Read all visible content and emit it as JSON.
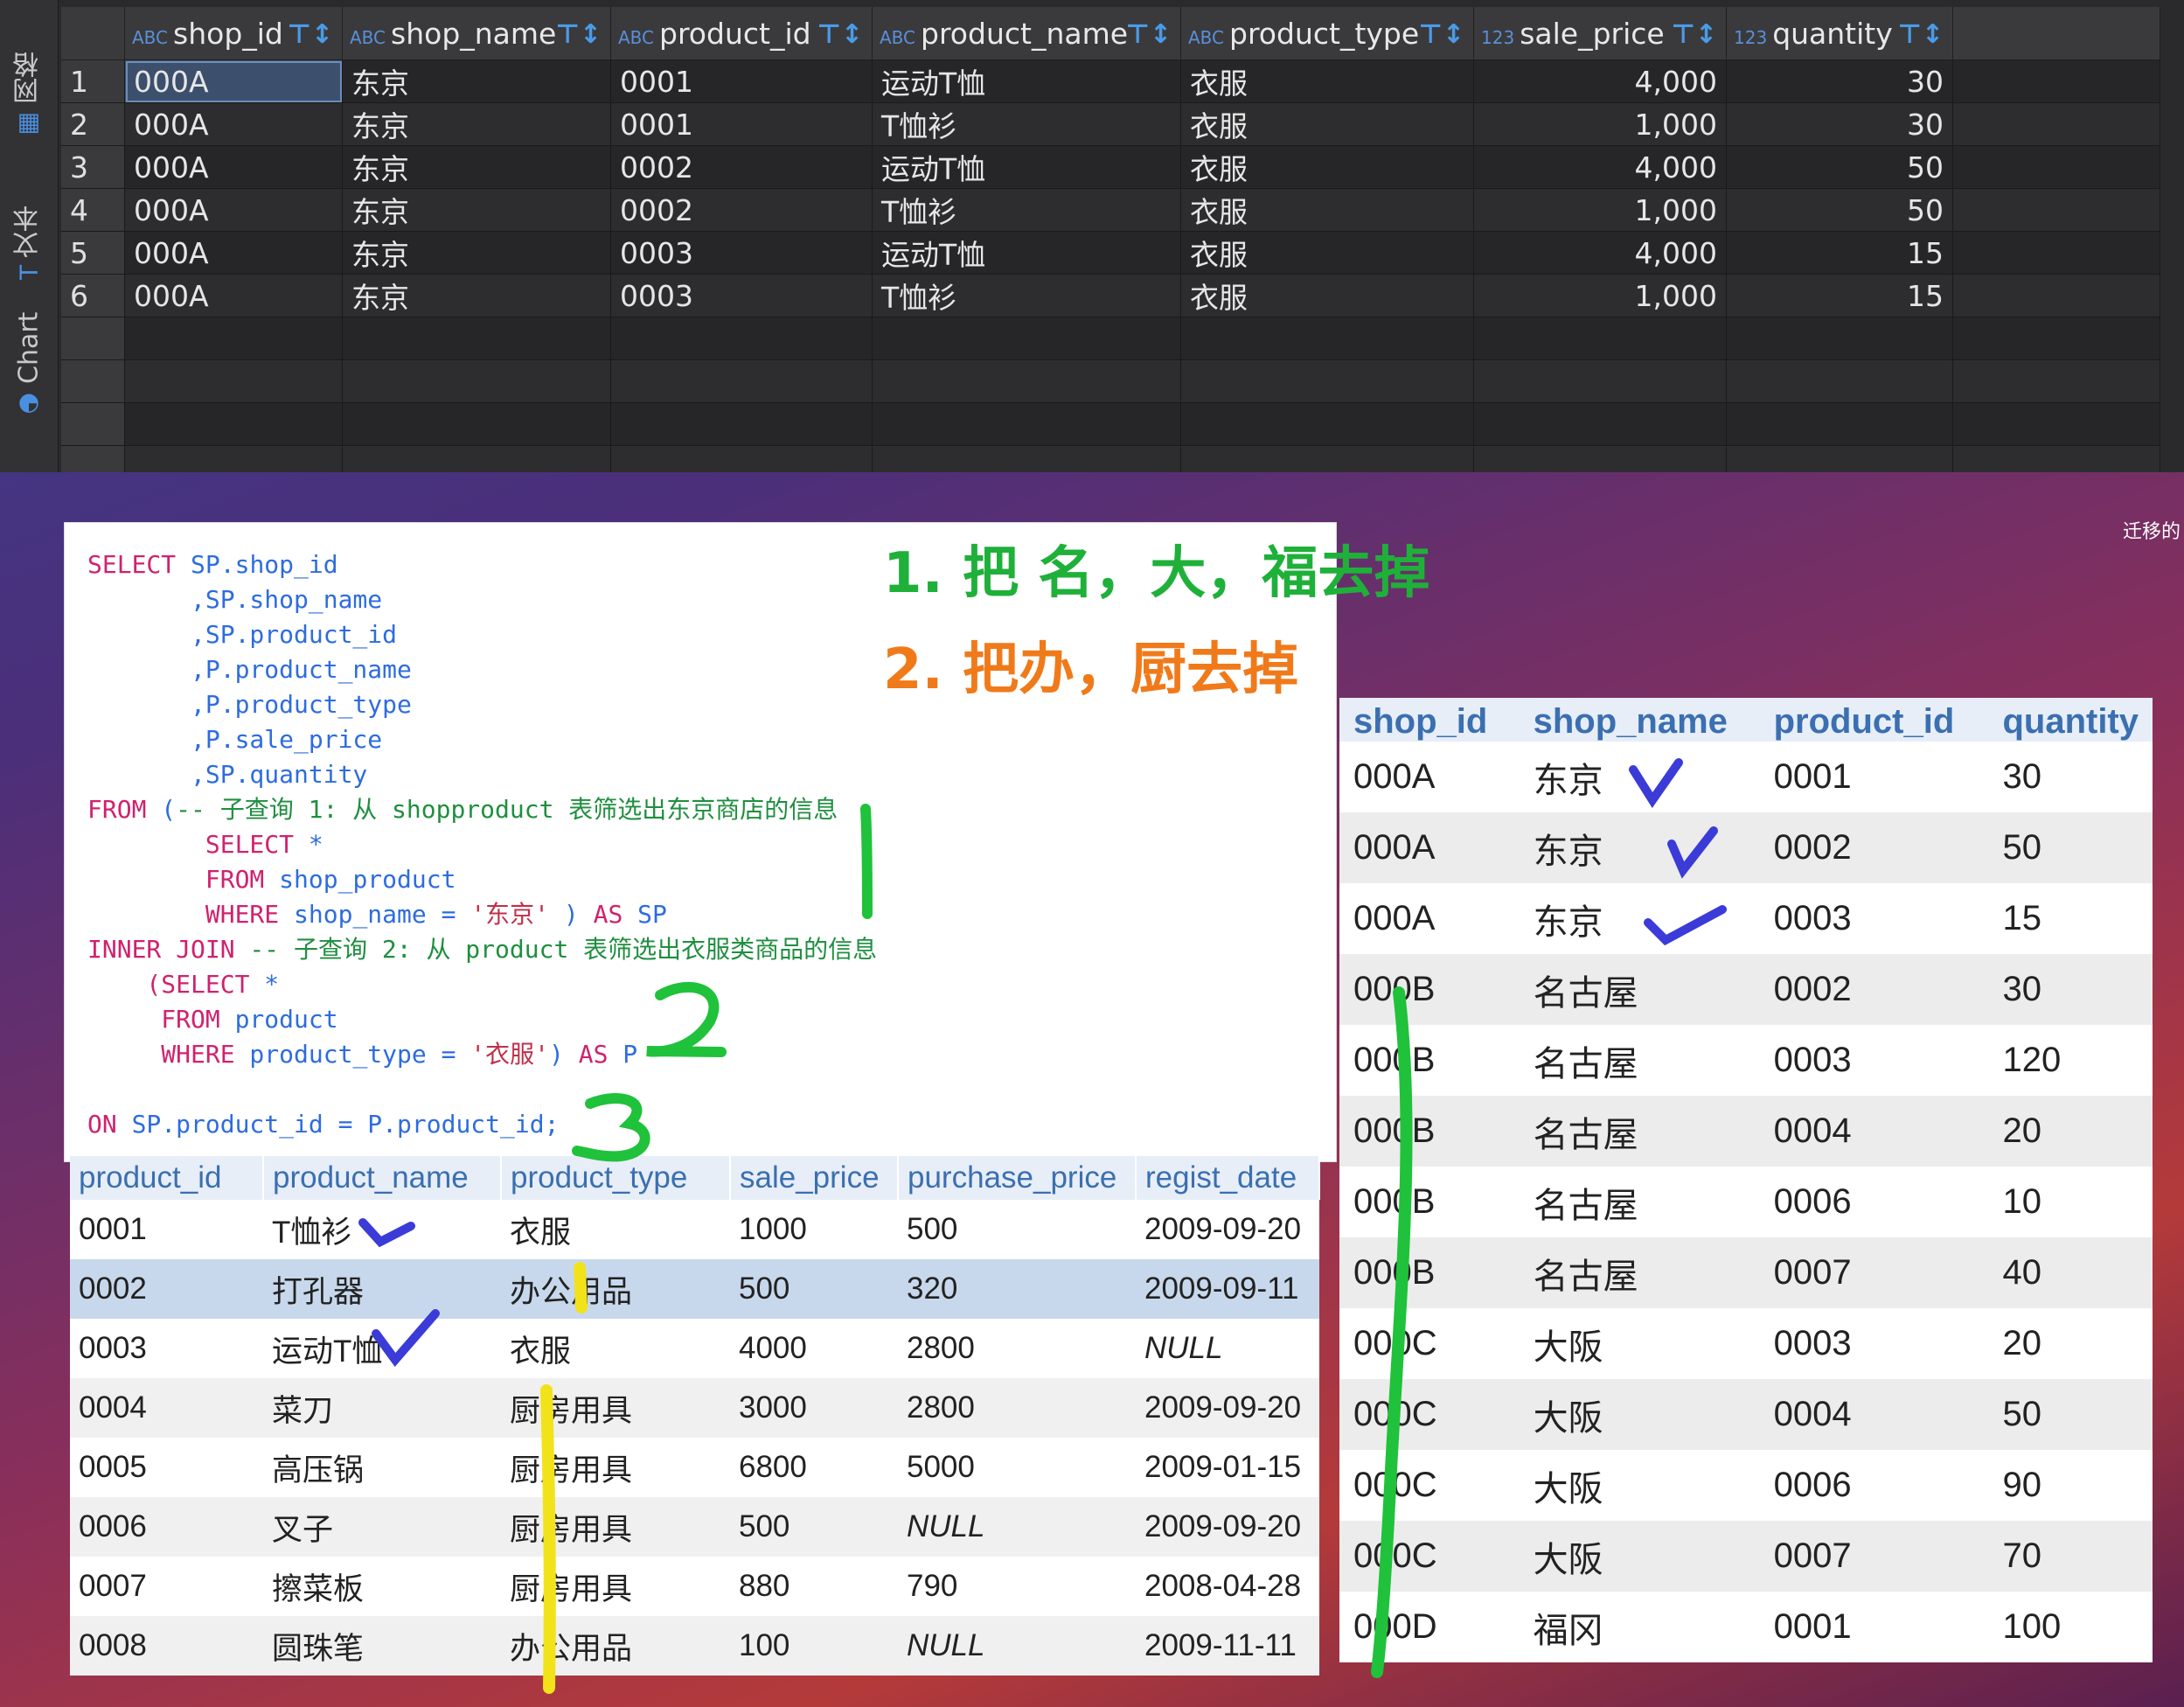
{
  "side_tabs": {
    "grid": "网格",
    "text": "文本",
    "chart": "Chart"
  },
  "grid": {
    "columns": [
      {
        "type": "ABC",
        "name": "shop_id"
      },
      {
        "type": "ABC",
        "name": "shop_name"
      },
      {
        "type": "ABC",
        "name": "product_id"
      },
      {
        "type": "ABC",
        "name": "product_name"
      },
      {
        "type": "ABC",
        "name": "product_type"
      },
      {
        "type": "123",
        "name": "sale_price"
      },
      {
        "type": "123",
        "name": "quantity"
      }
    ],
    "rows": [
      [
        "1",
        "000A",
        "东京",
        "0001",
        "运动T恤",
        "衣服",
        "4,000",
        "30"
      ],
      [
        "2",
        "000A",
        "东京",
        "0001",
        "T恤衫",
        "衣服",
        "1,000",
        "30"
      ],
      [
        "3",
        "000A",
        "东京",
        "0002",
        "运动T恤",
        "衣服",
        "4,000",
        "50"
      ],
      [
        "4",
        "000A",
        "东京",
        "0002",
        "T恤衫",
        "衣服",
        "1,000",
        "50"
      ],
      [
        "5",
        "000A",
        "东京",
        "0003",
        "运动T恤",
        "衣服",
        "4,000",
        "15"
      ],
      [
        "6",
        "000A",
        "东京",
        "0003",
        "T恤衫",
        "衣服",
        "1,000",
        "15"
      ]
    ]
  },
  "sql": {
    "l1a": "SELECT",
    "l1b": " SP.shop_id",
    "l2": "       ,SP.shop_name",
    "l3": "       ,SP.product_id",
    "l4": "       ,P.product_name",
    "l5": "       ,P.product_type",
    "l6": "       ,P.sale_price",
    "l7": "       ,SP.quantity",
    "l8a": "FROM",
    "l8b": " (",
    "l8c": "-- 子查询 1: 从 shopproduct 表筛选出东京商店的信息",
    "l9a": "        SELECT",
    "l9b": " *",
    "l10a": "        FROM",
    "l10b": " shop_product",
    "l11a": "        WHERE",
    "l11b": " shop_name = ",
    "l11c": "'东京'",
    "l11d": " ) ",
    "l11e": "AS",
    "l11f": " SP",
    "l12a": "INNER JOIN",
    "l12c": " -- 子查询 2: 从 product 表筛选出衣服类商品的信息",
    "l13a": "    (SELECT",
    "l13b": " *",
    "l14a": "     FROM",
    "l14b": " product",
    "l15a": "     WHERE",
    "l15b": " product_type = ",
    "l15c": "'衣服'",
    "l15d": ") ",
    "l15e": "AS",
    "l15f": " P",
    "l16": "",
    "l17a": "ON",
    "l17b": " SP.product_id = P.product_id;"
  },
  "notes": {
    "note1": "1. 把 名，大，福去掉",
    "note2": "2. 把办，厨去掉",
    "note1_color": "#1fb03a",
    "note2_color": "#f07a1a"
  },
  "product_table": {
    "headers": [
      "product_id",
      "product_name",
      "product_type",
      "sale_price",
      "purchase_price",
      "regist_date"
    ],
    "rows": [
      [
        "0001",
        "T恤衫",
        "衣服",
        "1000",
        "500",
        "2009-09-20"
      ],
      [
        "0002",
        "打孔器",
        "办公用品",
        "500",
        "320",
        "2009-09-11"
      ],
      [
        "0003",
        "运动T恤",
        "衣服",
        "4000",
        "2800",
        "NULL"
      ],
      [
        "0004",
        "菜刀",
        "厨房用具",
        "3000",
        "2800",
        "2009-09-20"
      ],
      [
        "0005",
        "高压锅",
        "厨房用具",
        "6800",
        "5000",
        "2009-01-15"
      ],
      [
        "0006",
        "叉子",
        "厨房用具",
        "500",
        "NULL",
        "2009-09-20"
      ],
      [
        "0007",
        "擦菜板",
        "厨房用具",
        "880",
        "790",
        "2008-04-28"
      ],
      [
        "0008",
        "圆珠笔",
        "办公用品",
        "100",
        "NULL",
        "2009-11-11"
      ]
    ]
  },
  "shop_table": {
    "headers": [
      "shop_id",
      "shop_name",
      "product_id",
      "quantity"
    ],
    "rows": [
      [
        "000A",
        "东京",
        "0001",
        "30"
      ],
      [
        "000A",
        "东京",
        "0002",
        "50"
      ],
      [
        "000A",
        "东京",
        "0003",
        "15"
      ],
      [
        "000B",
        "名古屋",
        "0002",
        "30"
      ],
      [
        "000B",
        "名古屋",
        "0003",
        "120"
      ],
      [
        "000B",
        "名古屋",
        "0004",
        "20"
      ],
      [
        "000B",
        "名古屋",
        "0006",
        "10"
      ],
      [
        "000B",
        "名古屋",
        "0007",
        "40"
      ],
      [
        "000C",
        "大阪",
        "0003",
        "20"
      ],
      [
        "000C",
        "大阪",
        "0004",
        "50"
      ],
      [
        "000C",
        "大阪",
        "0006",
        "90"
      ],
      [
        "000C",
        "大阪",
        "0007",
        "70"
      ],
      [
        "000D",
        "福冈",
        "0001",
        "100"
      ]
    ]
  },
  "annotations": {
    "n1": "1",
    "n2": "2",
    "n3": "3"
  },
  "edge": {
    "top_right": "迁移的"
  }
}
